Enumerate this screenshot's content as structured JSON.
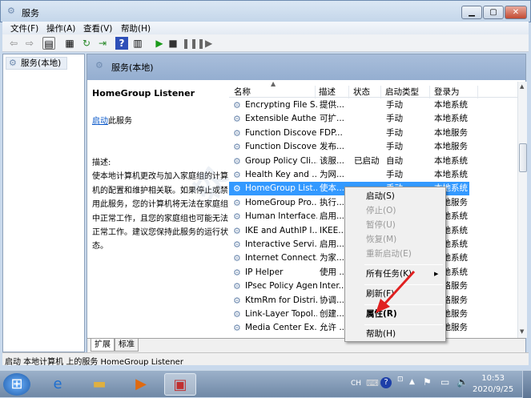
{
  "window": {
    "title": "服务",
    "minimize": "▁",
    "maximize": "▢",
    "close": "✕"
  },
  "menu": [
    "文件(F)",
    "操作(A)",
    "查看(V)",
    "帮助(H)"
  ],
  "tree": {
    "root": "服务(本地)"
  },
  "panel": {
    "header": "服务(本地)",
    "selected_name": "HomeGroup Listener",
    "start_link": "启动",
    "start_suffix": "此服务",
    "desc_label": "描述:",
    "desc_text": "使本地计算机更改与加入家庭组的计算机的配置和维护相关联。如果停止或禁用此服务，您的计算机将无法在家庭组中正常工作，且您的家庭组也可能无法正常工作。建议您保持此服务的运行状态。"
  },
  "columns": [
    "名称",
    "描述",
    "状态",
    "启动类型",
    "登录为"
  ],
  "rows": [
    [
      "Encrypting File S...",
      "提供...",
      "",
      "手动",
      "本地系统"
    ],
    [
      "Extensible Authe...",
      "可扩...",
      "",
      "手动",
      "本地系统"
    ],
    [
      "Function Discove...",
      "FDP...",
      "",
      "手动",
      "本地服务"
    ],
    [
      "Function Discove...",
      "发布...",
      "",
      "手动",
      "本地服务"
    ],
    [
      "Group Policy Cli...",
      "该服...",
      "已启动",
      "自动",
      "本地系统"
    ],
    [
      "Health Key and ...",
      "为网...",
      "",
      "手动",
      "本地系统"
    ],
    [
      "HomeGroup List...",
      "使本...",
      "",
      "手动",
      "本地系统"
    ],
    [
      "HomeGroup Pro...",
      "执行...",
      "",
      "",
      "本地服务"
    ],
    [
      "Human Interface...",
      "启用...",
      "",
      "",
      "本地系统"
    ],
    [
      "IKE and AuthIP I...",
      "IKEE...",
      "",
      "",
      "本地系统"
    ],
    [
      "Interactive Servi...",
      "启用...",
      "",
      "",
      "本地系统"
    ],
    [
      "Internet Connect...",
      "为家...",
      "",
      "",
      "本地系统"
    ],
    [
      "IP Helper",
      "使用 ...",
      "",
      "",
      "本地系统"
    ],
    [
      "IPsec Policy Agent",
      "Inter...",
      "",
      "",
      "网络服务"
    ],
    [
      "KtmRm for Distri...",
      "协调...",
      "",
      "",
      "网络服务"
    ],
    [
      "Link-Layer Topol...",
      "创建...",
      "",
      "",
      "本地服务"
    ],
    [
      "Media Center Ex...",
      "允许 ...",
      "",
      "",
      "本地服务"
    ]
  ],
  "tabs": [
    "扩展",
    "标准"
  ],
  "context_menu": {
    "start": "启动(S)",
    "stop": "停止(O)",
    "pause": "暂停(U)",
    "resume": "恢复(M)",
    "restart": "重新启动(E)",
    "all_tasks": "所有任务(K)",
    "refresh": "刷新(F)",
    "properties": "属性(R)",
    "help": "帮助(H)"
  },
  "status_bar": "启动 本地计算机 上的服务 HomeGroup Listener",
  "tray": {
    "lang": "CH",
    "time": "10:53",
    "date": "2020/9/25"
  },
  "watermark": "软件网",
  "colors": {
    "selection": "#3399ff",
    "arrow": "#e02020"
  }
}
